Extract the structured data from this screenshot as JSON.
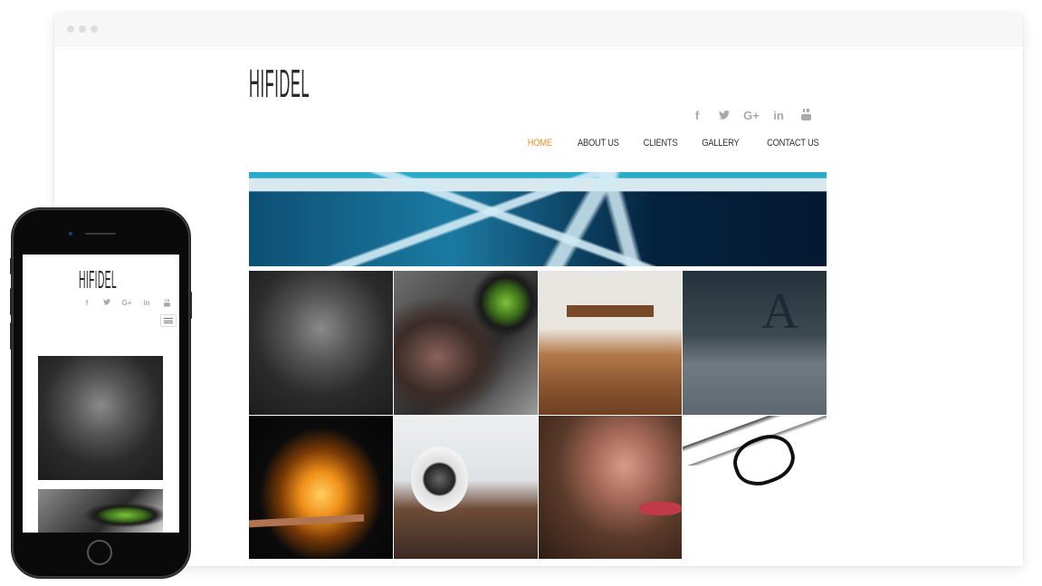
{
  "site": {
    "logo": "HIFIDEL",
    "social_icons": [
      {
        "name": "facebook-icon",
        "glyph": "f"
      },
      {
        "name": "twitter-icon",
        "glyph": "🐦"
      },
      {
        "name": "google-plus-icon",
        "glyph": "G+"
      },
      {
        "name": "linkedin-icon",
        "glyph": "in"
      },
      {
        "name": "youtube-icon",
        "glyph": "▣"
      }
    ],
    "nav": [
      {
        "label": "HOME",
        "active": true
      },
      {
        "label": "ABOUT US",
        "active": false
      },
      {
        "label": "CLIENTS",
        "active": false
      },
      {
        "label": "GALLERY",
        "active": false
      },
      {
        "label": "CONTACT US",
        "active": false
      }
    ],
    "accent_color": "#f0902a",
    "banner": {
      "subject": "abstract blue geometric lines"
    },
    "gallery": [
      {
        "subject": "headphones"
      },
      {
        "subject": "cat eye"
      },
      {
        "subject": "dining chairs"
      },
      {
        "subject": "letter A decor"
      },
      {
        "subject": "burning match"
      },
      {
        "subject": "speaker on desk"
      },
      {
        "subject": "painted face"
      },
      {
        "subject": "sketch with glasses"
      }
    ]
  },
  "mobile": {
    "logo": "HIFIDEL",
    "social_glyphs": [
      "f",
      "🐦",
      "G+",
      "in",
      "▣"
    ],
    "menu_icon": "hamburger-menu-icon"
  }
}
